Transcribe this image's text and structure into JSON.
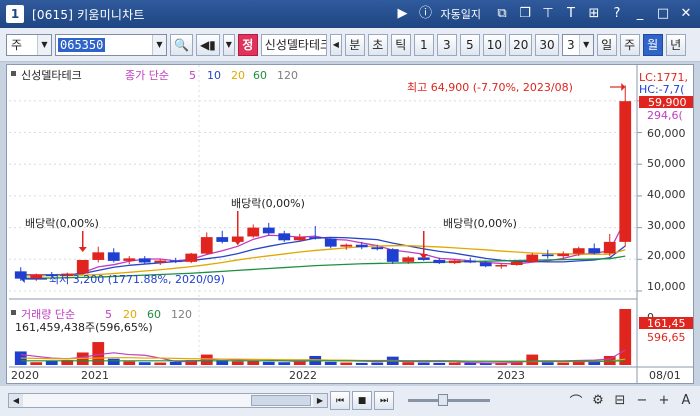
{
  "window": {
    "number": "1",
    "title": "[0615] 키움미니차트",
    "auto_journal": "자동일지"
  },
  "toolbar": {
    "market": "주",
    "code": "065350",
    "btn_jeong": "정",
    "stock_name": "신성델타테크",
    "period_prefix": [
      "분",
      "초",
      "틱"
    ],
    "periods": [
      "1",
      "3",
      "5",
      "10",
      "20",
      "30"
    ],
    "interval_value": "3",
    "range": [
      "일",
      "주",
      "월",
      "년"
    ],
    "selected_range": "월"
  },
  "chart": {
    "legend": {
      "name": "신성델타테크",
      "ma_label": "종가 단순",
      "ma_periods": [
        "5",
        "10",
        "20",
        "60",
        "120"
      ],
      "ma_colors": [
        "#c03cc0",
        "#2845c8",
        "#e2a800",
        "#1e8f3e",
        "#7f7f7f"
      ]
    },
    "high_annotation": "최고 64,900 (-7.70%, 2023/08)",
    "low_annotation": "최저 3,200 (1771.88%, 2020/09)",
    "dividend_label": "배당락(0,00%)",
    "price_axis": [
      "60,000",
      "50,000",
      "40,000",
      "30,000",
      "20,000",
      "10,000",
      "0"
    ],
    "price_tags": {
      "lc": "LC:1771,",
      "hc": "HC:-7,7(",
      "last": "59,900",
      "ma": "294,6("
    },
    "volume_legend": {
      "label": "거래량 단순",
      "ma_periods": [
        "5",
        "20",
        "60",
        "120"
      ],
      "ma_colors": [
        "#c03cc0",
        "#e2a800",
        "#1e8f3e",
        "#7f7f7f"
      ],
      "max_annotation": "161,459,438주(596,65%)",
      "tag_max": "161,45",
      "tag_pct": "596,65"
    },
    "x_axis": [
      "2020",
      "2021",
      "2022",
      "2023",
      "08/01"
    ],
    "colors": {
      "up": "#e0251f",
      "down": "#1f3fd0"
    },
    "chart_data": {
      "type": "candlestick",
      "interval": "monthly",
      "ylim": [
        0,
        65000
      ],
      "candles": [
        {
          "o": 6200,
          "h": 7500,
          "l": 3200,
          "c": 3900
        },
        {
          "o": 3800,
          "h": 5500,
          "l": 3200,
          "c": 5200
        },
        {
          "o": 5200,
          "h": 6000,
          "l": 4300,
          "c": 4700
        },
        {
          "o": 4700,
          "h": 5800,
          "l": 4200,
          "c": 5500
        },
        {
          "o": 5500,
          "h": 8000,
          "l": 5200,
          "c": 9800
        },
        {
          "o": 9800,
          "h": 14000,
          "l": 9000,
          "c": 12200
        },
        {
          "o": 12200,
          "h": 13500,
          "l": 9000,
          "c": 9500
        },
        {
          "o": 9500,
          "h": 11000,
          "l": 8500,
          "c": 10300
        },
        {
          "o": 10300,
          "h": 11000,
          "l": 8500,
          "c": 9000
        },
        {
          "o": 9000,
          "h": 10000,
          "l": 8200,
          "c": 9600
        },
        {
          "o": 9600,
          "h": 10500,
          "l": 8800,
          "c": 9200
        },
        {
          "o": 9200,
          "h": 12000,
          "l": 8800,
          "c": 11800
        },
        {
          "o": 11800,
          "h": 18500,
          "l": 11500,
          "c": 17000
        },
        {
          "o": 17000,
          "h": 19000,
          "l": 15000,
          "c": 15500
        },
        {
          "o": 15500,
          "h": 18000,
          "l": 14500,
          "c": 17200
        },
        {
          "o": 17200,
          "h": 21000,
          "l": 16800,
          "c": 20000
        },
        {
          "o": 20000,
          "h": 21500,
          "l": 17500,
          "c": 18200
        },
        {
          "o": 18200,
          "h": 19000,
          "l": 15500,
          "c": 16000
        },
        {
          "o": 16000,
          "h": 18000,
          "l": 15500,
          "c": 17000
        },
        {
          "o": 17000,
          "h": 20500,
          "l": 16200,
          "c": 16500
        },
        {
          "o": 16500,
          "h": 17000,
          "l": 13500,
          "c": 14000
        },
        {
          "o": 14000,
          "h": 15000,
          "l": 13000,
          "c": 14600
        },
        {
          "o": 14600,
          "h": 15500,
          "l": 13200,
          "c": 13800
        },
        {
          "o": 13800,
          "h": 14600,
          "l": 12800,
          "c": 13200
        },
        {
          "o": 13200,
          "h": 13500,
          "l": 8500,
          "c": 9200
        },
        {
          "o": 9200,
          "h": 11000,
          "l": 8500,
          "c": 10600
        },
        {
          "o": 10600,
          "h": 11500,
          "l": 9500,
          "c": 9800
        },
        {
          "o": 9800,
          "h": 10500,
          "l": 8500,
          "c": 8800
        },
        {
          "o": 8800,
          "h": 10000,
          "l": 8500,
          "c": 9600
        },
        {
          "o": 9600,
          "h": 10500,
          "l": 8800,
          "c": 9000
        },
        {
          "o": 9000,
          "h": 9500,
          "l": 7500,
          "c": 7800
        },
        {
          "o": 7800,
          "h": 8500,
          "l": 7000,
          "c": 8200
        },
        {
          "o": 8200,
          "h": 9500,
          "l": 8000,
          "c": 9200
        },
        {
          "o": 9200,
          "h": 12000,
          "l": 9000,
          "c": 11500
        },
        {
          "o": 11500,
          "h": 13000,
          "l": 10200,
          "c": 11000
        },
        {
          "o": 11000,
          "h": 12500,
          "l": 10000,
          "c": 11800
        },
        {
          "o": 11800,
          "h": 14000,
          "l": 11000,
          "c": 13500
        },
        {
          "o": 13500,
          "h": 15000,
          "l": 11500,
          "c": 11900
        },
        {
          "o": 11900,
          "h": 18000,
          "l": 11000,
          "c": 15500
        },
        {
          "o": 15500,
          "h": 64900,
          "l": 14000,
          "c": 59900
        }
      ],
      "volume": [
        39,
        8,
        12,
        14,
        36,
        66,
        18,
        10,
        8,
        7,
        9,
        14,
        30,
        14,
        10,
        13,
        9,
        8,
        11,
        26,
        9,
        7,
        6,
        7,
        24,
        8,
        7,
        6,
        7,
        6,
        6,
        7,
        9,
        30,
        8,
        7,
        12,
        9,
        26,
        161
      ],
      "ma_price": [
        [
          5100,
          5100,
          5000,
          4900,
          5800,
          7600,
          8300,
          9400,
          10100,
          10100,
          9500,
          10000,
          11500,
          12700,
          14100,
          16300,
          17600,
          17400,
          17000,
          17300,
          16300,
          16100,
          15200,
          14300,
          12900,
          12300,
          11600,
          10300,
          10000,
          9500,
          9000,
          8700,
          8500,
          9100,
          9500,
          10300,
          11500,
          11900,
          12700,
          22400
        ],
        [
          5000,
          5000,
          5100,
          5100,
          5500,
          6500,
          7500,
          8100,
          8500,
          8900,
          9300,
          9600,
          10200,
          10800,
          11800,
          13100,
          14100,
          15000,
          15700,
          16700,
          16900,
          16800,
          16500,
          16200,
          15100,
          14200,
          13300,
          12500,
          11900,
          11100,
          10300,
          9700,
          9300,
          9300,
          9200,
          9200,
          9500,
          9800,
          10500,
          14200
        ],
        [
          4800,
          4800,
          4850,
          4900,
          5000,
          5200,
          5500,
          5900,
          6300,
          6700,
          7200,
          7700,
          8300,
          9000,
          9800,
          10500,
          11100,
          11700,
          12300,
          12800,
          13200,
          13600,
          14000,
          14200,
          14300,
          14300,
          14100,
          13900,
          13600,
          13300,
          13000,
          12600,
          12300,
          12000,
          11800,
          11700,
          11700,
          11600,
          11600,
          13000
        ],
        [
          4000,
          4050,
          4100,
          4200,
          4300,
          4400,
          4600,
          4800,
          5000,
          5200,
          5400,
          5600,
          5900,
          6200,
          6500,
          6800,
          7100,
          7400,
          7700,
          8000,
          8200,
          8400,
          8600,
          8700,
          8800,
          8900,
          9000,
          9100,
          9200,
          9300,
          9400,
          9500,
          9600,
          9700,
          9800,
          9900,
          10000,
          10100,
          10200,
          11000
        ]
      ],
      "ma_volume": [
        [
          30,
          25,
          20,
          18,
          22,
          30,
          35,
          30,
          28,
          20,
          10,
          10,
          15,
          17,
          15,
          16,
          15,
          12,
          10,
          13,
          13,
          12,
          11,
          10,
          11,
          10,
          10,
          10,
          10,
          7,
          6,
          6,
          7,
          12,
          12,
          12,
          13,
          14,
          17,
          43
        ],
        [
          20,
          19,
          18,
          18,
          19,
          20,
          21,
          21,
          20,
          20,
          19,
          18,
          18,
          17,
          17,
          16,
          16,
          15,
          15,
          15,
          14,
          14,
          13,
          13,
          13,
          12,
          12,
          12,
          11,
          11,
          11,
          10,
          10,
          10,
          10,
          10,
          10,
          10,
          11,
          17
        ],
        [
          12,
          12,
          12,
          12,
          12,
          12,
          12,
          12,
          12,
          12,
          12,
          12,
          12,
          12,
          12,
          12,
          12,
          12,
          12,
          12,
          12,
          12,
          12,
          12,
          12,
          12,
          12,
          12,
          12,
          11,
          11,
          11,
          11,
          11,
          11,
          11,
          11,
          11,
          11,
          12
        ]
      ]
    }
  }
}
